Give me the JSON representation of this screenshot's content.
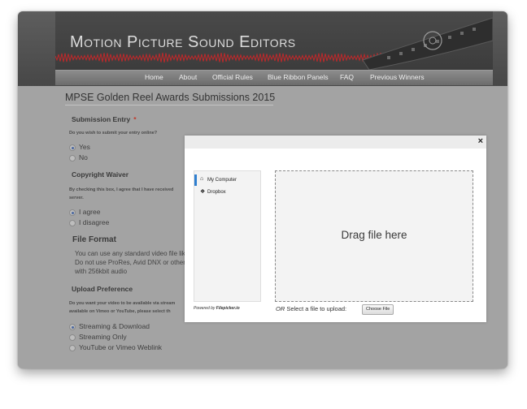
{
  "site": {
    "title": "Motion Picture Sound Editors",
    "nav": [
      "Home",
      "About",
      "Official Rules",
      "Blue Ribbon Panels",
      "FAQ",
      "Previous Winners"
    ]
  },
  "form": {
    "page_title": "MPSE Golden Reel Awards Submissions 2015",
    "submission": {
      "heading": "Submission Entry",
      "required_mark": "*",
      "question": "Do you wish to submit your entry online?",
      "options": [
        "Yes",
        "No"
      ],
      "selected": "Yes"
    },
    "copyright": {
      "heading": "Copyright Waiver",
      "question_line1": "By checking this box, I agree that I have received",
      "question_line2": "server.",
      "options": [
        "I agree",
        "I disagree"
      ],
      "selected": "I agree"
    },
    "file_format": {
      "heading": "File Format",
      "lines": [
        "You can use any standard video file like",
        "Do not use ProRes, Avid DNX or other",
        "with 256kbit audio"
      ]
    },
    "upload": {
      "heading": "Upload Preference",
      "question_line1": "Do you want your video to be available via stream",
      "question_line2": "available on Vimeo or YouTube, please select th",
      "options": [
        "Streaming & Download",
        "Streaming Only",
        "YouTube or Vimeo Weblink"
      ],
      "selected": "Streaming & Download"
    }
  },
  "picker": {
    "close": "×",
    "sources": [
      {
        "label": "My Computer",
        "icon": "home-icon",
        "glyph": "⌂",
        "active": true
      },
      {
        "label": "Dropbox",
        "icon": "dropbox-icon",
        "glyph": "❖",
        "active": false
      }
    ],
    "powered_prefix": "Powered by",
    "powered_brand": "Filepicker.io",
    "drop_text": "Drag file here",
    "or_prefix": "OR",
    "or_text": "Select a file to upload:",
    "choose_button": "Choose File"
  },
  "colors": {
    "header": "#4a4a4a",
    "overlay": "#a3a3a3",
    "accent_blue": "#2f7fd0",
    "waveform_red": "#c0282a"
  }
}
